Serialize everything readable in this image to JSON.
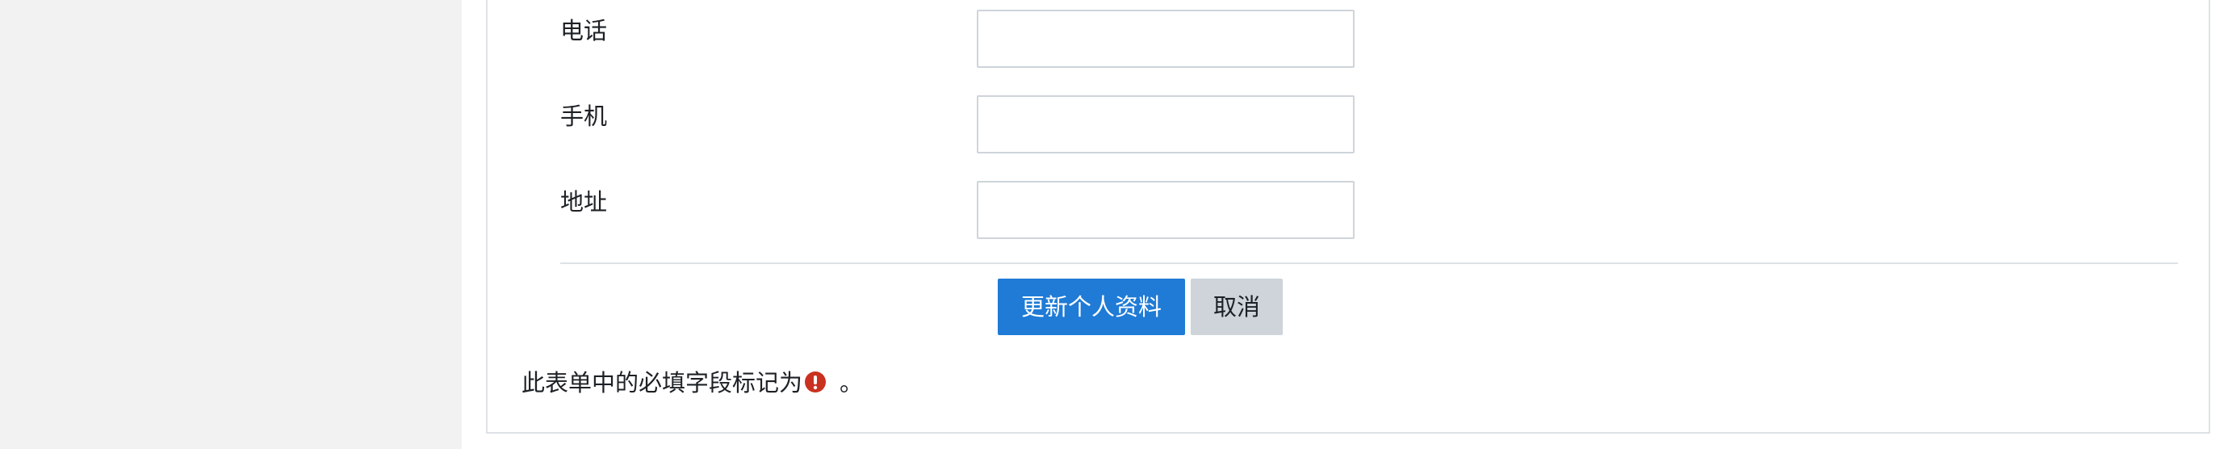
{
  "form": {
    "fields": [
      {
        "label": "电话",
        "value": "",
        "placeholder": ""
      },
      {
        "label": "手机",
        "value": "",
        "placeholder": ""
      },
      {
        "label": "地址",
        "value": "",
        "placeholder": ""
      }
    ],
    "submit_label": "更新个人资料",
    "cancel_label": "取消",
    "required_note": "此表单中的必填字段标记为",
    "required_note_tail": "。",
    "required_icon": "exclamation-circle-icon"
  },
  "colors": {
    "primary": "#1f7bd6",
    "secondary": "#ced4da",
    "required": "#ca3120",
    "sidebar_bg": "#f2f2f2"
  }
}
